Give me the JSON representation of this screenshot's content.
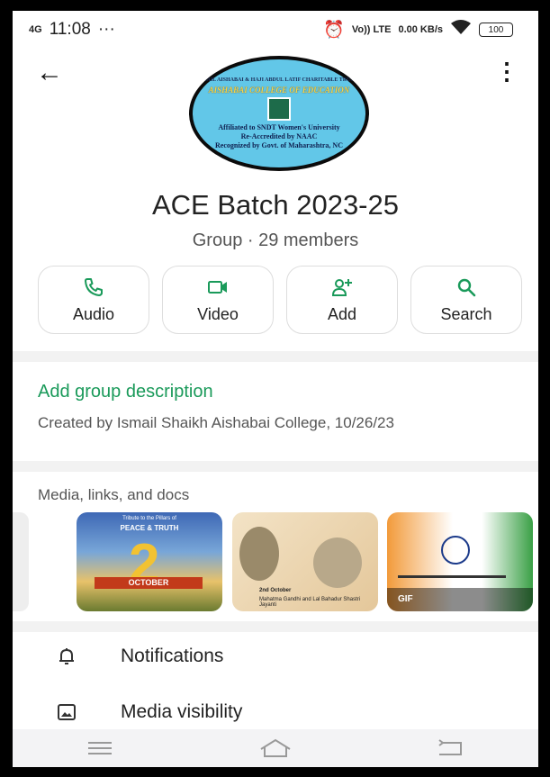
{
  "status_bar": {
    "network": "4G",
    "time": "11:08",
    "extra": "···",
    "vol_lte": "Vo)) LTE",
    "speed": "0.00 KB/s",
    "battery": "100"
  },
  "group": {
    "name": "ACE Batch 2023-25",
    "meta": "Group · 29 members",
    "avatar": {
      "org": "ISMAIL AISHABAI & HAJI ABDUL LATIF CHARITABLE TRUST'S",
      "college": "AISHABAI COLLEGE OF EDUCATION",
      "line1": "Affiliated to SNDT Women's University",
      "line2": "Re-Accredited by NAAC",
      "line3": "Recognized by Govt. of Maharashtra, NC"
    }
  },
  "actions": [
    {
      "label": "Audio",
      "icon": "phone-icon"
    },
    {
      "label": "Video",
      "icon": "video-icon"
    },
    {
      "label": "Add",
      "icon": "add-person-icon"
    },
    {
      "label": "Search",
      "icon": "search-icon"
    }
  ],
  "description": {
    "link": "Add group description",
    "created": "Created by Ismail Shaikh Aishabai College, 10/26/23"
  },
  "media": {
    "title": "Media, links, and docs",
    "thumb1_top": "Tribute to the Pillars of",
    "thumb1_title": "PEACE & TRUTH",
    "thumb1_num": "2",
    "thumb1_month": "OCTOBER",
    "thumb2_line1": "2nd October",
    "thumb2_line2": "Mahatma Gandhi and Lal Bahadur Shastri Jayanti",
    "gif_label": "GIF"
  },
  "list": [
    {
      "label": "Notifications",
      "icon": "bell-icon"
    },
    {
      "label": "Media visibility",
      "icon": "image-icon"
    }
  ],
  "colors": {
    "accent_green": "#1a9a5a",
    "text": "#222222"
  }
}
